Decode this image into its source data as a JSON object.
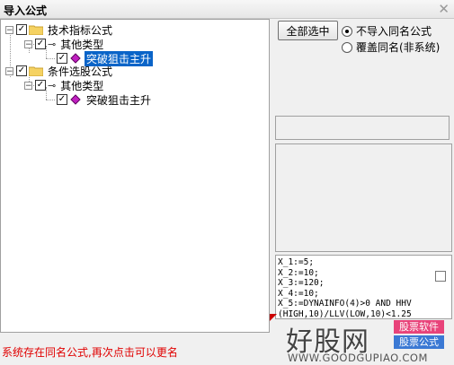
{
  "window": {
    "title": "导入公式",
    "close_icon": "close-icon"
  },
  "tree": [
    {
      "label": "技术指标公式",
      "icon": "folder-icon",
      "checked": true,
      "expanded": true,
      "children": [
        {
          "label": "其他类型",
          "icon": "key-icon",
          "checked": true,
          "expanded": true,
          "children": [
            {
              "label": "突破狙击主升",
              "icon": "gem-icon",
              "checked": true,
              "selected": true
            }
          ]
        }
      ]
    },
    {
      "label": "条件选股公式",
      "icon": "folder-icon",
      "checked": true,
      "expanded": true,
      "children": [
        {
          "label": "其他类型",
          "icon": "key-icon",
          "checked": true,
          "expanded": true,
          "children": [
            {
              "label": "突破狙击主升",
              "icon": "gem-icon",
              "checked": true,
              "selected": false
            }
          ]
        }
      ]
    }
  ],
  "controls": {
    "select_all_label": "全部选中",
    "options": [
      {
        "label": "不导入同名公式",
        "selected": true
      },
      {
        "label": "覆盖同名(非系统)",
        "selected": false
      }
    ]
  },
  "code_lines": [
    "X_1:=5;",
    "X_2:=10;",
    "X_3:=120;",
    "X_4:=10;",
    "X_5:=DYNAINFO(4)>0 AND HHV",
    "(HIGH,10)/LLV(LOW,10)<1.25"
  ],
  "status_text": "系统存在同名公式,再次点击可以更名",
  "watermark": {
    "brand": "好股网",
    "tag1": "股票软件",
    "tag2": "股票公式",
    "url": "WWW.GOODGUPIAO.COM"
  },
  "colors": {
    "selection": "#0a64c8",
    "status": "#e00000",
    "tag1": "#e8437a",
    "tag2": "#3b79d4"
  }
}
